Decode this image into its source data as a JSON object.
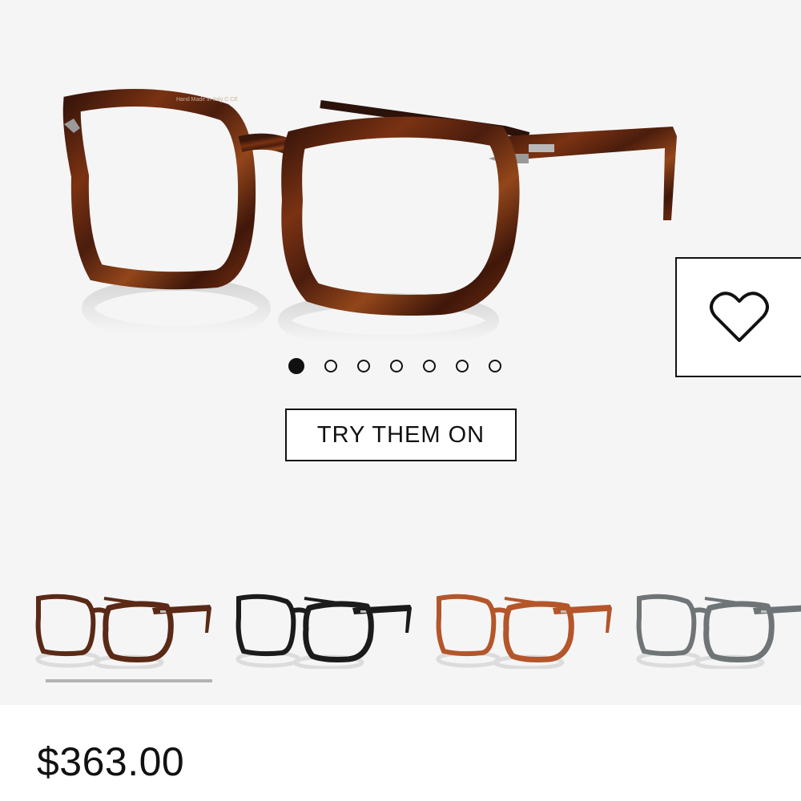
{
  "product": {
    "price": "$363.00"
  },
  "gallery": {
    "main_image": "tortoise-square-eyeglasses",
    "wishlist_icon": "heart-icon",
    "dots_total": 7,
    "active_dot": 1,
    "try_on_label": "TRY THEM ON"
  },
  "variants": [
    {
      "name": "tortoise",
      "frame_color": "#5a2a16",
      "selected": true
    },
    {
      "name": "black",
      "frame_color": "#1b1b1b",
      "selected": false
    },
    {
      "name": "caramel",
      "frame_color": "#b4552a",
      "selected": false
    },
    {
      "name": "grey",
      "frame_color": "#6f7477",
      "selected": false
    }
  ],
  "colors": {
    "gallery_background": "#f5f5f5",
    "border": "#111111",
    "selected_underline": "#b3b3b3"
  }
}
